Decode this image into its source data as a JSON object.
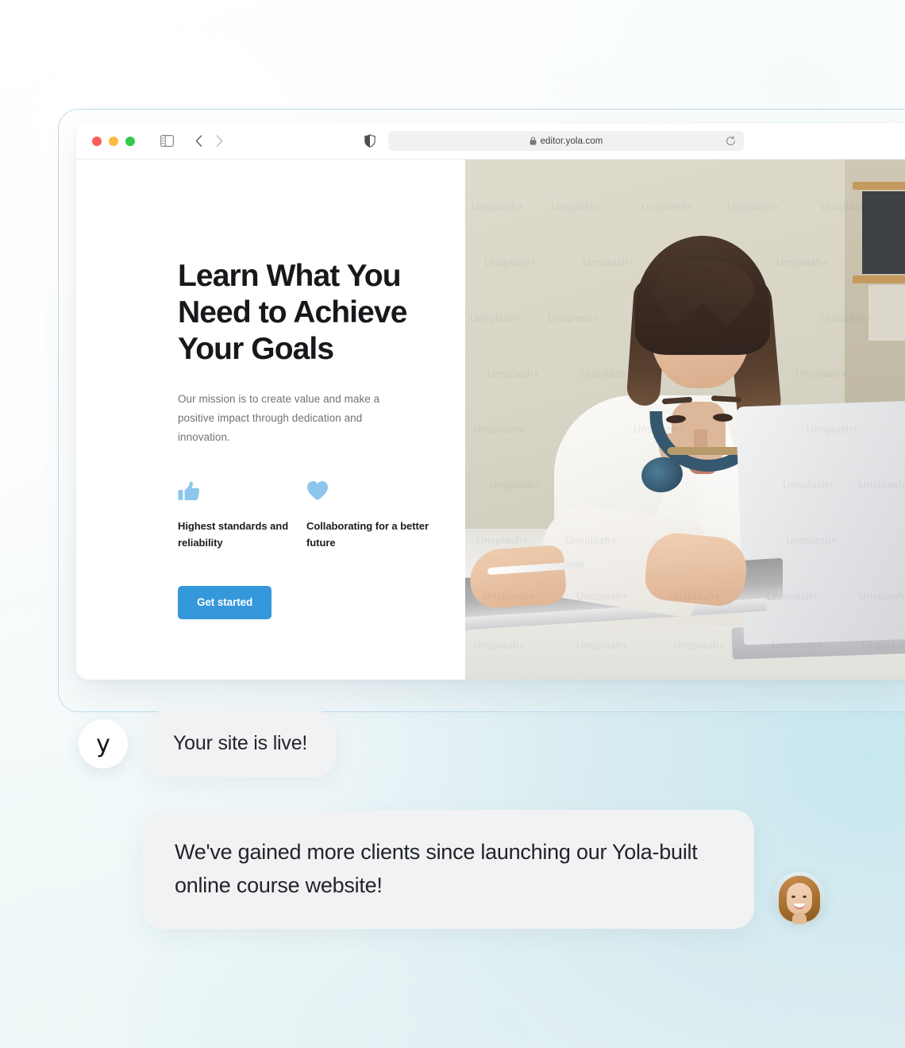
{
  "browser": {
    "window_controls": [
      "close",
      "minimize",
      "maximize"
    ],
    "sidebar_toggle_name": "sidebar-toggle-icon",
    "back_label": "‹",
    "forward_label": "›",
    "shield_name": "privacy-shield-icon",
    "lock_name": "lock-icon",
    "url": "editor.yola.com",
    "reload_name": "reload-icon"
  },
  "site": {
    "hero_title": "Learn What You Need to Achieve Your Goals",
    "hero_subtitle": "Our mission is to create value and make a positive impact through dedication and innovation.",
    "features": [
      {
        "icon": "thumbs-up-icon",
        "label": "Highest standards and reliability"
      },
      {
        "icon": "heart-icon",
        "label": "Collaborating for a better future"
      }
    ],
    "cta_label": "Get started",
    "photo_alt": "Woman with blue headphones working on a laptop and tablet at a white desk",
    "photo_watermark": "Unsplash+"
  },
  "chat": {
    "messages": [
      {
        "avatar_type": "yola-logo",
        "avatar_text": "y",
        "text": "Your site is live!"
      },
      {
        "avatar_type": "client-photo",
        "avatar_text": "",
        "text": "We've gained more clients since launching our Yola-built online course website!"
      }
    ]
  },
  "colors": {
    "accent_blue": "#3498db",
    "icon_blue": "#8dc6ec",
    "bubble_bg": "#f1f2f3",
    "text_dark": "#17181b",
    "text_muted": "#6f7377",
    "frame_border": "#bcdcee",
    "bg_teal": "#d2e9ef"
  }
}
